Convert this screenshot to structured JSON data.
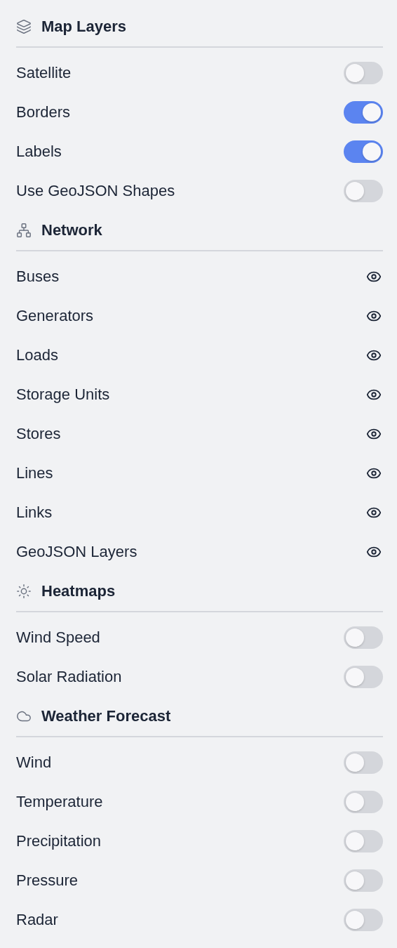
{
  "sections": [
    {
      "title": "Map Layers",
      "items": [
        {
          "kind": "toggle",
          "label": "Satellite",
          "on": false
        },
        {
          "kind": "toggle",
          "label": "Borders",
          "on": true
        },
        {
          "kind": "toggle",
          "label": "Labels",
          "on": true
        },
        {
          "kind": "toggle",
          "label": "Use GeoJSON Shapes",
          "on": false
        }
      ]
    },
    {
      "title": "Network",
      "items": [
        {
          "kind": "visibility",
          "label": "Buses",
          "visible": true
        },
        {
          "kind": "visibility",
          "label": "Generators",
          "visible": true
        },
        {
          "kind": "visibility",
          "label": "Loads",
          "visible": true
        },
        {
          "kind": "visibility",
          "label": "Storage Units",
          "visible": true
        },
        {
          "kind": "visibility",
          "label": "Stores",
          "visible": true
        },
        {
          "kind": "visibility",
          "label": "Lines",
          "visible": true
        },
        {
          "kind": "visibility",
          "label": "Links",
          "visible": true
        },
        {
          "kind": "visibility",
          "label": "GeoJSON Layers",
          "visible": true
        }
      ]
    },
    {
      "title": "Heatmaps",
      "items": [
        {
          "kind": "toggle",
          "label": "Wind Speed",
          "on": false
        },
        {
          "kind": "toggle",
          "label": "Solar Radiation",
          "on": false
        }
      ]
    },
    {
      "title": "Weather Forecast",
      "items": [
        {
          "kind": "toggle",
          "label": "Wind",
          "on": false
        },
        {
          "kind": "toggle",
          "label": "Temperature",
          "on": false
        },
        {
          "kind": "toggle",
          "label": "Precipitation",
          "on": false
        },
        {
          "kind": "toggle",
          "label": "Pressure",
          "on": false
        },
        {
          "kind": "toggle",
          "label": "Radar",
          "on": false
        }
      ]
    }
  ]
}
